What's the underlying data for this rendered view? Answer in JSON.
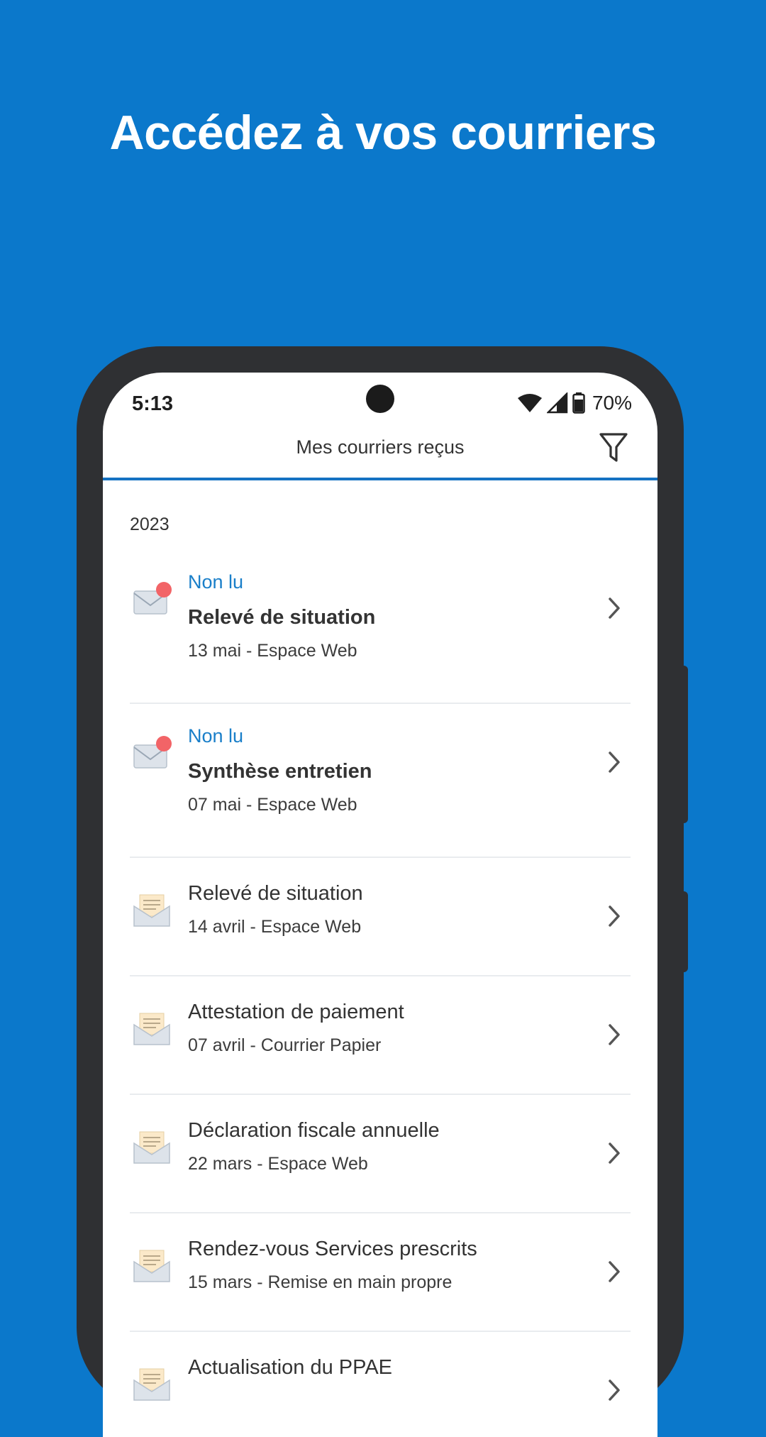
{
  "headline": "Accédez à vos courriers",
  "status": {
    "time": "5:13",
    "battery": "70%"
  },
  "appbar": {
    "title": "Mes courriers reçus",
    "filter_icon": "filter-icon"
  },
  "year": "2023",
  "colors": {
    "background": "#0b78cb",
    "accent": "#1572c2",
    "unread_dot": "#f26467"
  },
  "letters": [
    {
      "status": "Non lu",
      "title": "Relevé de situation",
      "meta": "13 mai - Espace Web",
      "unread": true
    },
    {
      "status": "Non lu",
      "title": "Synthèse entretien",
      "meta": "07 mai - Espace Web",
      "unread": true
    },
    {
      "title": "Relevé de situation",
      "meta": "14 avril - Espace Web",
      "unread": false
    },
    {
      "title": "Attestation de paiement",
      "meta": "07 avril - Courrier Papier",
      "unread": false
    },
    {
      "title": "Déclaration fiscale annuelle",
      "meta": "22 mars - Espace Web",
      "unread": false
    },
    {
      "title": "Rendez-vous Services prescrits",
      "meta": "15 mars - Remise en main propre",
      "unread": false
    },
    {
      "title": "Actualisation du PPAE",
      "meta": "",
      "unread": false
    }
  ]
}
